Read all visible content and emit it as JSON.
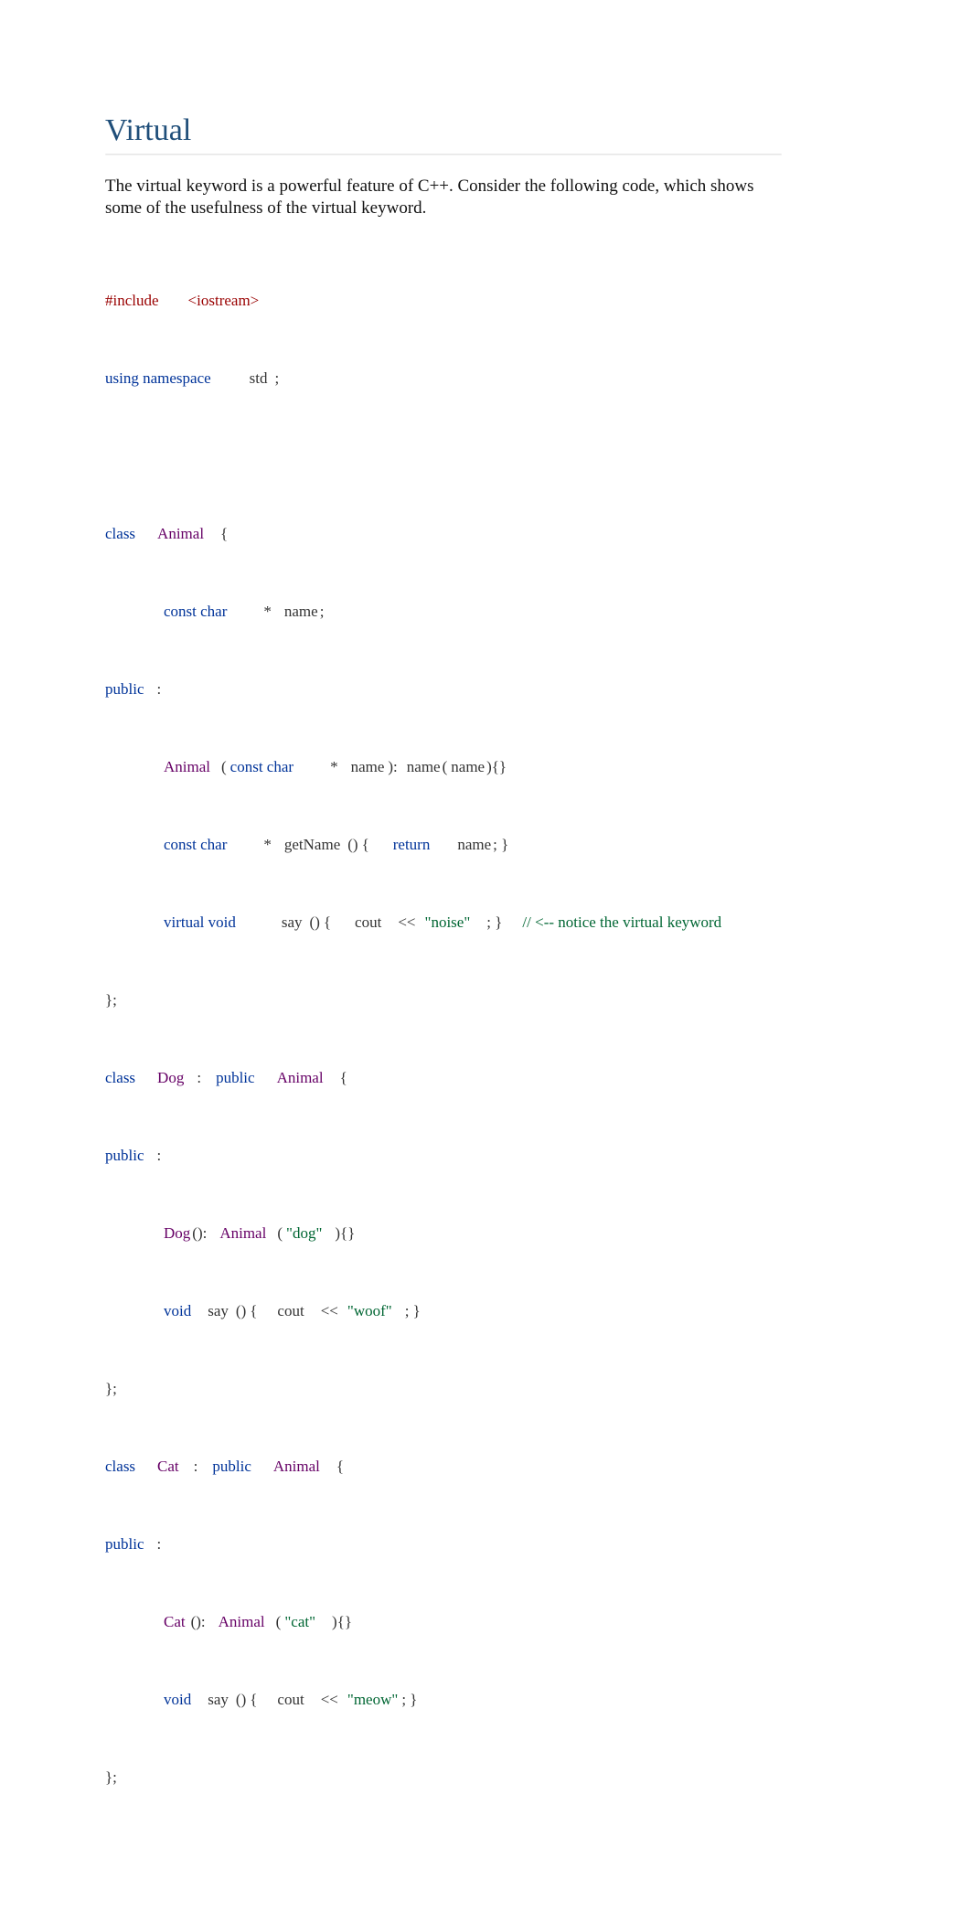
{
  "heading": "Virtual",
  "intro": {
    "part1": "The ",
    "kw": "virtual",
    "part2": " keyword is a powerful feature of C++. Consider the following code, which shows some of the usefulness of the virtual keyword."
  },
  "code": {
    "include": {
      "directive": "#include",
      "header": "<iostream>"
    },
    "using": {
      "kw": "using namespace",
      "name": "std",
      "semi": ";"
    },
    "classAnimal": {
      "classKw": "class",
      "name": "Animal",
      "open": "{",
      "field": {
        "constChar": "const char",
        "star": "*",
        "name": "name",
        "semi": ";"
      },
      "publicKw": "public",
      "colon": ":",
      "ctor": {
        "name": "Animal",
        "lparen": "(",
        "constChar": "const char",
        "star": "*",
        "param": "name",
        "rparen": "):",
        "init": "name",
        "initL": "(",
        "initArg": "name",
        "initR": "){}"
      },
      "getter": {
        "constChar": "const char",
        "star": "*",
        "name": "getName",
        "paren": "()",
        "lbrace": "{",
        "ret": "return",
        "retVal": "name",
        "end": "; }"
      },
      "say": {
        "virtualVoid": "virtual void",
        "name": "say",
        "paren": "()",
        "lbrace": "{",
        "cout": "cout",
        "shift": "<<",
        "str": "\"noise\"",
        "end": "; }",
        "comment": "// <-- notice the virtual keyword"
      },
      "close": "};"
    },
    "classDog": {
      "classKw": "class",
      "name": "Dog",
      "colon": ":",
      "publicKw": "public",
      "base": "Animal",
      "open": "{",
      "publicLabel": "public",
      "publicColon": ":",
      "ctor": {
        "name": "Dog",
        "paren": "():",
        "base": "Animal",
        "lparen": "(",
        "arg": "\"dog\"",
        "rparen": "){}"
      },
      "say": {
        "voidKw": "void",
        "name": "say",
        "paren": "()",
        "lbrace": "{",
        "cout": "cout",
        "shift": "<<",
        "str": "\"woof\"",
        "end": "; }"
      },
      "close": "};"
    },
    "classCat": {
      "classKw": "class",
      "name": "Cat",
      "colon": ":",
      "publicKw": "public",
      "base": "Animal",
      "open": "{",
      "publicLabel": "public",
      "publicColon": ":",
      "ctor": {
        "name": "Cat",
        "paren": "():",
        "base": "Animal",
        "lparen": "(",
        "arg": "\"cat\"",
        "rparen": "){}"
      },
      "say": {
        "voidKw": "void",
        "name": "say",
        "paren": "()",
        "lbrace": "{",
        "cout": "cout",
        "shift": "<<",
        "str": "\"meow\"",
        "end": "; }"
      },
      "close": "};"
    }
  }
}
